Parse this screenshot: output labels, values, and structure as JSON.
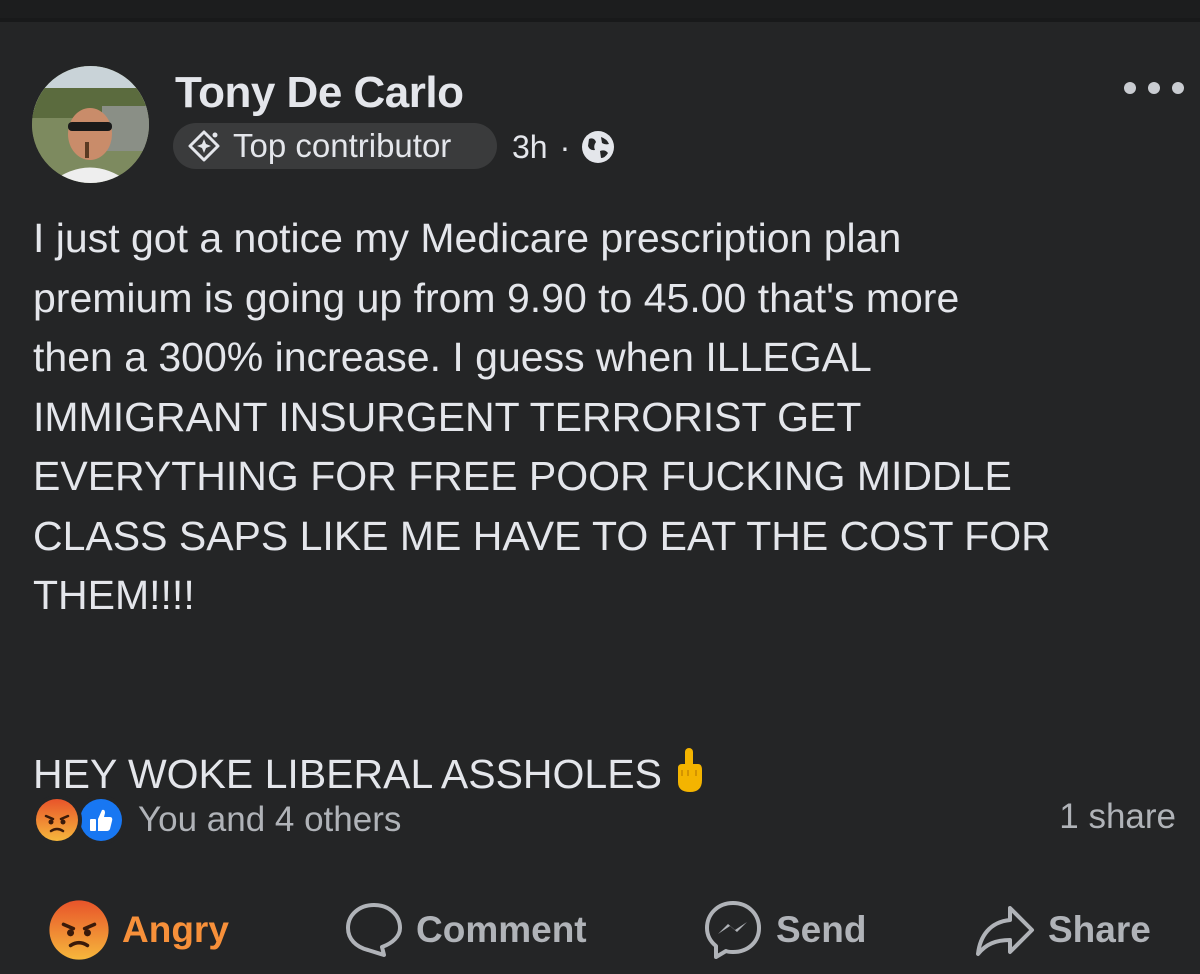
{
  "post": {
    "author": "Tony De Carlo",
    "badge_label": "Top contributor",
    "time": "3h",
    "separator": "·",
    "privacy_icon": "globe-icon",
    "badge_icon": "sparkle-badge-icon",
    "more_icon": "more-dots-icon",
    "body_lines": [
      "I just got a notice my Medicare prescription plan",
      "premium is going up from 9.90 to 45.00 that's more",
      "then a 300% increase. I guess when ILLEGAL",
      "IMMIGRANT INSURGENT TERRORIST GET",
      "EVERYTHING FOR FREE POOR FUCKING MIDDLE",
      "CLASS SAPS LIKE ME HAVE TO EAT THE COST FOR",
      "THEM!!!!"
    ],
    "closing_line": "HEY WOKE LIBERAL ASSHOLES",
    "closing_emoji": "middle-finger-emoji"
  },
  "engagement": {
    "reaction_icons": [
      "angry-reaction-icon",
      "like-reaction-icon"
    ],
    "reactions_text": "You and 4 others",
    "share_count": "1 share"
  },
  "actions": {
    "angry_label": "Angry",
    "comment_label": "Comment",
    "send_label": "Send",
    "share_label": "Share"
  },
  "colors": {
    "background": "#242526",
    "text_primary": "#e4e6eb",
    "text_secondary": "#b0b3b8",
    "angry_accent": "#f7903a",
    "like_blue": "#1877f2",
    "badge_bg": "#3a3b3c"
  }
}
